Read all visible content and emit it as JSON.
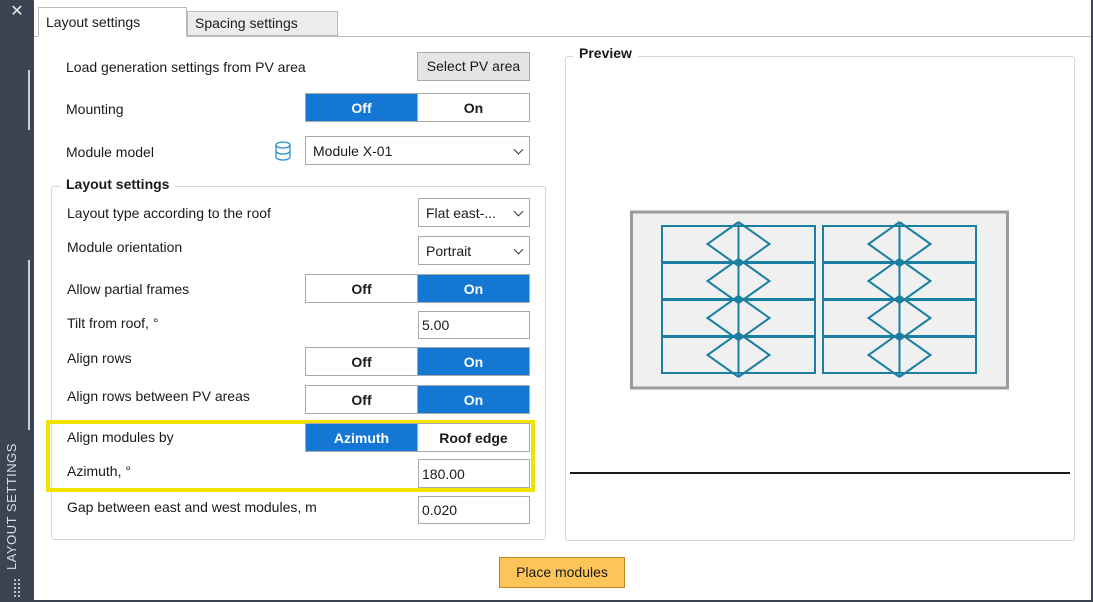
{
  "palette": {
    "title": "LAYOUT SETTINGS"
  },
  "tabs": [
    {
      "label": "Layout settings",
      "active": true
    },
    {
      "label": "Spacing settings",
      "active": false
    }
  ],
  "top": {
    "load_label": "Load generation settings from PV area",
    "select_pv_button": "Select PV area",
    "mounting_label": "Mounting",
    "mounting_off": "Off",
    "mounting_on": "On",
    "mounting_value": "Off",
    "module_model_label": "Module model",
    "module_model_value": "Module X-01"
  },
  "layout": {
    "group_title": "Layout settings",
    "layout_type_label": "Layout type according to the roof",
    "layout_type_value": "Flat east-...",
    "orientation_label": "Module orientation",
    "orientation_value": "Portrait",
    "partial_label": "Allow partial frames",
    "partial_off": "Off",
    "partial_on": "On",
    "partial_value": "On",
    "tilt_label": "Tilt from roof, °",
    "tilt_value": "5.00",
    "align_rows_label": "Align rows",
    "align_rows_off": "Off",
    "align_rows_on": "On",
    "align_rows_value": "On",
    "align_rows_pv_label": "Align rows between PV areas",
    "align_rows_pv_off": "Off",
    "align_rows_pv_on": "On",
    "align_rows_pv_value": "On",
    "align_by_label": "Align modules by",
    "align_by_azimuth": "Azimuth",
    "align_by_roof": "Roof edge",
    "align_by_value": "Azimuth",
    "azimuth_label": "Azimuth, °",
    "azimuth_value": "180.00",
    "gap_label": "Gap between east and west modules,  m",
    "gap_value": "0.020"
  },
  "preview": {
    "title": "Preview"
  },
  "place_button": "Place modules",
  "colors": {
    "accent": "#1477d4",
    "highlight": "#f2e200",
    "module_stroke": "#1a7fa0",
    "place_button": "#fdc45a"
  }
}
